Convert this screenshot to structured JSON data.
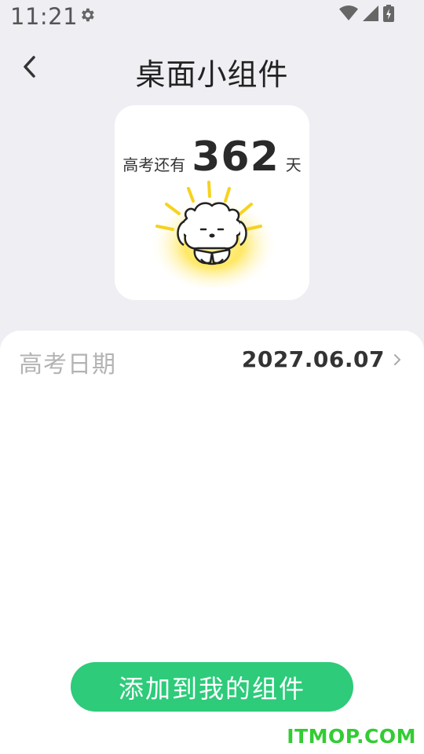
{
  "status_bar": {
    "time": "11:21",
    "icons": [
      "gear-icon",
      "wifi-icon",
      "signal-icon",
      "battery-charging-icon"
    ]
  },
  "header": {
    "title": "桌面小组件",
    "back_icon": "chevron-left-icon"
  },
  "widget": {
    "prefix": "高考还有",
    "days": "362",
    "unit": "天",
    "mascot_icon": "dog-mascot-icon"
  },
  "settings": {
    "date_label": "高考日期",
    "date_value": "2027.06.07",
    "chevron_icon": "chevron-right-icon"
  },
  "actions": {
    "add_button_label": "添加到我的组件"
  },
  "watermark": "ITMOP.COM",
  "colors": {
    "page_background": "#efeff3",
    "accent_green": "#2dcb7a",
    "glow_yellow": "#ffe04a",
    "watermark_green": "#33cc33"
  }
}
